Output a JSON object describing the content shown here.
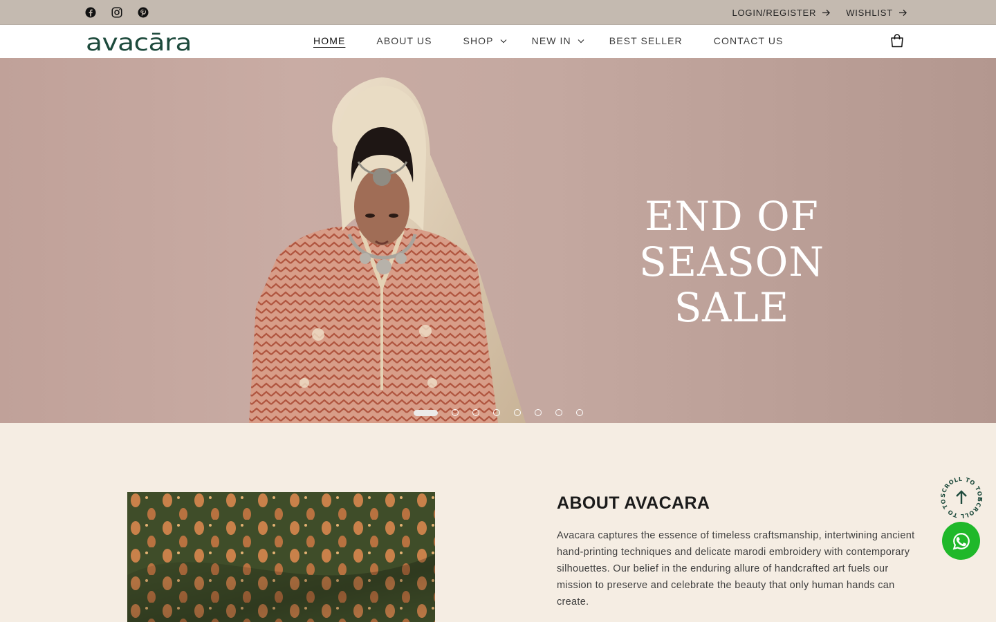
{
  "topbar": {
    "social": [
      "facebook-icon",
      "instagram-icon",
      "pinterest-icon"
    ],
    "login_label": "LOGIN/REGISTER",
    "wishlist_label": "WISHLIST"
  },
  "header": {
    "logo_text": "avacāra",
    "nav": [
      {
        "label": "HOME",
        "active": true
      },
      {
        "label": "ABOUT US"
      },
      {
        "label": "SHOP",
        "dropdown": true
      },
      {
        "label": "NEW IN",
        "dropdown": true
      },
      {
        "label": "BEST SELLER"
      },
      {
        "label": "CONTACT US"
      }
    ],
    "cart_icon": "cart-icon"
  },
  "hero": {
    "title_line1": "END OF",
    "title_line2": "SEASON SALE",
    "slide_count": 8,
    "active_slide": 1
  },
  "about": {
    "title": "ABOUT AVACARA",
    "text": "Avacara captures the essence of timeless craftsmanship, intertwining ancient hand-printing techniques and delicate marodi embroidery with contemporary silhouettes. Our belief in the enduring allure of handcrafted art fuels our mission to preserve and celebrate the beauty that only human hands can create."
  },
  "floating": {
    "scroll_label": "SCROLL TO TOP",
    "whatsapp_icon": "whatsapp-icon"
  },
  "colors": {
    "brand": "#1d4a3c",
    "topbar": "#c4bab0",
    "page_bg": "#f5ede3",
    "whatsapp": "#1fb82a"
  }
}
